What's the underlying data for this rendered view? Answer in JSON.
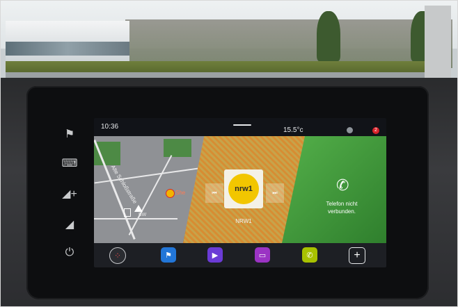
{
  "status": {
    "time": "10:36",
    "temperature": "15.5°c",
    "notification_count": "2"
  },
  "map": {
    "street_label": "Alte Schloßstraße",
    "poi_label": "She",
    "road_label": "BW"
  },
  "radio": {
    "logo_text": "nrw1",
    "station_name": "NRW1",
    "prev_glyph": "⏮",
    "next_glyph": "⏭"
  },
  "phone": {
    "icon_glyph": "✆",
    "status_text": "Telefon nicht verbunden."
  },
  "dock": {
    "apps_glyph": "⁘",
    "nav_glyph": "⚑",
    "media_glyph": "▶",
    "video_glyph": "▭",
    "phone_glyph": "✆",
    "add_glyph": "+"
  },
  "side": {
    "flag_glyph": "⚑",
    "keyboard_glyph": "⌨",
    "vol_up_glyph": "◢+",
    "vol_down_glyph": "◢",
    "power_glyph": "⏻"
  },
  "colors": {
    "phone_tile": "#3f9b3a",
    "nav_app": "#2276d8",
    "media_app": "#6b3bd6",
    "video_app": "#9b33c4",
    "phone_app": "#a8c100",
    "notification": "#d8222a"
  }
}
